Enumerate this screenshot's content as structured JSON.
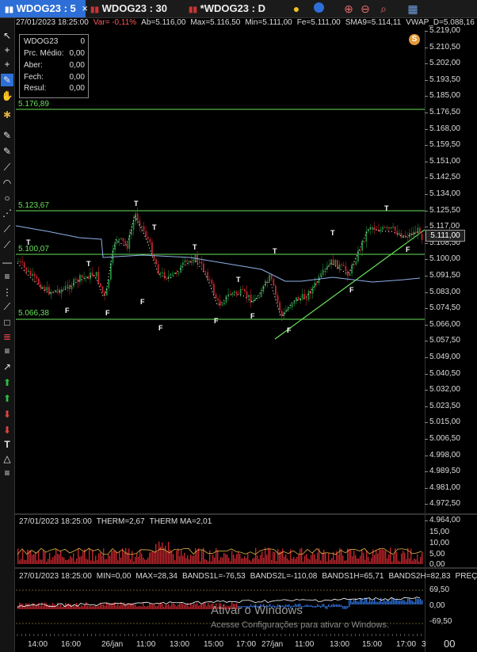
{
  "tabs": [
    {
      "label": "WDOG23 : 5",
      "close": "×",
      "active": true
    },
    {
      "label": "WDOG23 : 30",
      "active": false
    },
    {
      "label": "*WDOG23 : D",
      "active": false
    }
  ],
  "toolbar_icons": [
    "lightbulb-icon",
    "clock-icon",
    "zoom-in-icon",
    "zoom-out-icon",
    "magnifier-icon",
    "chart-icon"
  ],
  "info": {
    "date": "27/01/2023 18:25:00",
    "var": "Var= -0,11%",
    "ab": "Ab=5.116,00",
    "max": "Max=5.116,50",
    "min": "Min=5.111,00",
    "fe": "Fe=5.111,00",
    "sma": "SMA9=5.114,11",
    "vwap": "VWAP_D=5.088,16"
  },
  "infobox": {
    "symbol": "WDOG23",
    "symbol_val": "0",
    "rows": [
      {
        "k": "Prc. Médio:",
        "v": "0,00"
      },
      {
        "k": "Aber:",
        "v": "0,00"
      },
      {
        "k": "Fech:",
        "v": "0,00"
      },
      {
        "k": "Resul:",
        "v": "0,00"
      }
    ]
  },
  "coin": "S",
  "price_axis": [
    "5.219,00",
    "5.210,50",
    "5.202,00",
    "5.193,50",
    "5.185,00",
    "5.176,50",
    "5.168,00",
    "5.159,50",
    "5.151,00",
    "5.142,50",
    "5.134,00",
    "5.125,50",
    "5.117,00",
    "5.108,50",
    "5.100,00",
    "5.091,50",
    "5.083,00",
    "5.074,50",
    "5.066,00",
    "5.057,50",
    "5.049,00",
    "5.040,50",
    "5.032,00",
    "5.023,50",
    "5.015,00",
    "5.006,50",
    "4.998,00",
    "4.989,50",
    "4.981,00",
    "4.972,50",
    "4.964,00"
  ],
  "levels": [
    "5.176,89",
    "5.123,67",
    "5.100,07",
    "5.066,38"
  ],
  "current_price": "5.111,00",
  "therm": {
    "date": "27/01/2023 18:25:00",
    "therm": "THERM=2,67",
    "therm_ma": "THERM MA=2,01",
    "axis": [
      "15,00",
      "10,00",
      "5,00",
      "0,00"
    ]
  },
  "bands": {
    "date": "27/01/2023 18:25:00",
    "min": "MIN=0,00",
    "max": "MAX=28,34",
    "b1l": "BANDS1L=-76,53",
    "b2l": "BANDS2L=-110,08",
    "b1h": "BANDS1H=65,71",
    "b2h": "BANDS2H=82,83",
    "preco": "PREÇO",
    "axis": [
      "69,50",
      "0,00",
      "-69,50"
    ]
  },
  "time_labels": [
    "14:00",
    "16:00",
    "26/jan",
    "11:00",
    "13:00",
    "15:00",
    "17:00",
    "27/jan",
    "11:00",
    "13:00",
    "15:00",
    "17:00"
  ],
  "time_axis_extra": [
    "3",
    "00"
  ],
  "watermark": {
    "title": "Ativar o Windows",
    "sub": "Acesse Configurações para ativar o Windows."
  },
  "colors": {
    "up": "#1e8c3a",
    "down": "#c0262d",
    "level": "#69e25a",
    "tab_active": "#2d6fd6",
    "vwap": "#8fb0e8"
  }
}
